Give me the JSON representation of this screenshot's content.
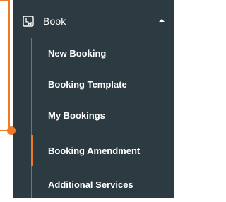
{
  "menu": {
    "section_title": "Book",
    "section_icon": "book-icon",
    "items": [
      {
        "label": "New Booking"
      },
      {
        "label": "Booking Template"
      },
      {
        "label": "My Bookings"
      },
      {
        "label": "Booking Amendment",
        "active": true
      },
      {
        "label": "Additional Services"
      }
    ]
  },
  "colors": {
    "panel_bg": "#2c3a42",
    "accent": "#f07a28",
    "track": "#6a7780",
    "text": "#ffffff"
  }
}
